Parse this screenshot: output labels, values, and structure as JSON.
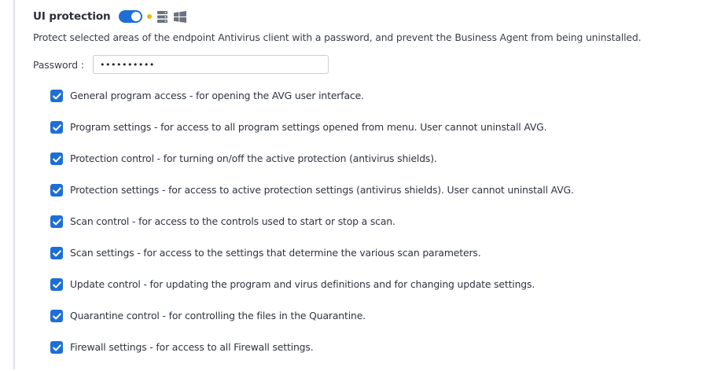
{
  "section": {
    "title": "UI protection",
    "toggle_state": "on",
    "accent_color": "#1d6fd6",
    "status_dot_color": "#f5b400",
    "platform_icons": [
      "server-icon",
      "windows-icon"
    ]
  },
  "description": "Protect selected areas of the endpoint Antivirus client with a password, and prevent the Business Agent from being uninstalled.",
  "password": {
    "label": "Password :",
    "value": "••••••••••"
  },
  "options": [
    {
      "label": "General program access - for opening the AVG user interface.",
      "checked": true
    },
    {
      "label": "Program settings - for access to all program settings opened from menu. User cannot uninstall AVG.",
      "checked": true
    },
    {
      "label": "Protection control - for turning on/off the active protection (antivirus shields).",
      "checked": true
    },
    {
      "label": "Protection settings - for access to active protection settings (antivirus shields). User cannot uninstall AVG.",
      "checked": true
    },
    {
      "label": "Scan control - for access to the controls used to start or stop a scan.",
      "checked": true
    },
    {
      "label": "Scan settings - for access to the settings that determine the various scan parameters.",
      "checked": true
    },
    {
      "label": "Update control - for updating the program and virus definitions and for changing update settings.",
      "checked": true
    },
    {
      "label": "Quarantine control - for controlling the files in the Quarantine.",
      "checked": true
    },
    {
      "label": "Firewall settings - for access to all Firewall settings.",
      "checked": true
    }
  ]
}
